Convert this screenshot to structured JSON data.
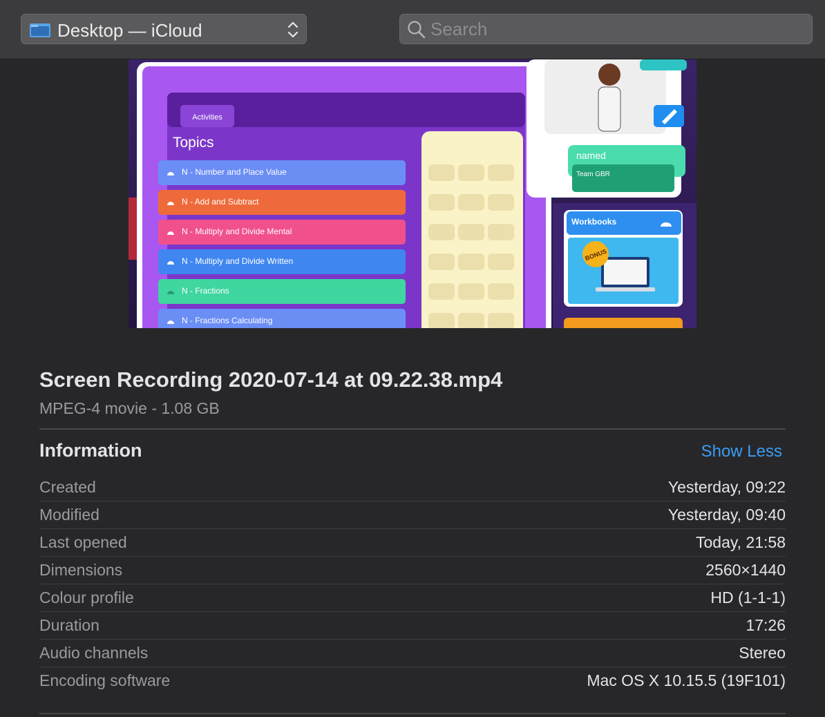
{
  "toolbar": {
    "location_label": "Desktop — iCloud",
    "search_placeholder": "Search"
  },
  "preview": {
    "tab_label": "Activities",
    "heading": "Topics",
    "topics": [
      {
        "label": "N - Number and Place Value",
        "color": "#6b8ef5"
      },
      {
        "label": "N - Add and Subtract",
        "color": "#ef6a3a"
      },
      {
        "label": "N - Multiply and Divide Mental",
        "color": "#f0508c"
      },
      {
        "label": "N - Multiply and Divide Written",
        "color": "#3f86f0"
      },
      {
        "label": "N - Fractions",
        "color": "#3fd6a0"
      },
      {
        "label": "N - Fractions Calculating",
        "color": "#6b8ef5"
      }
    ],
    "named_label": "named",
    "team_label": "Team GBR",
    "workbooks_label": "Workbooks",
    "bonus_label": "BONUS"
  },
  "file": {
    "name": "Screen Recording 2020-07-14 at 09.22.38.mp4",
    "kind_size": "MPEG-4 movie - 1.08 GB"
  },
  "information": {
    "title": "Information",
    "toggle_label": "Show Less",
    "rows": [
      {
        "key": "Created",
        "value": "Yesterday, 09:22"
      },
      {
        "key": "Modified",
        "value": "Yesterday, 09:40"
      },
      {
        "key": "Last opened",
        "value": "Today, 21:58"
      },
      {
        "key": "Dimensions",
        "value": "2560×1440"
      },
      {
        "key": "Colour profile",
        "value": "HD (1-1-1)"
      },
      {
        "key": "Duration",
        "value": "17:26"
      },
      {
        "key": "Audio channels",
        "value": "Stereo"
      },
      {
        "key": "Encoding software",
        "value": "Mac OS X 10.15.5 (19F101)"
      }
    ]
  },
  "colors": {
    "accent_link": "#3c9cf5",
    "background": "#272729",
    "toolbar": "#3b3b3d"
  }
}
